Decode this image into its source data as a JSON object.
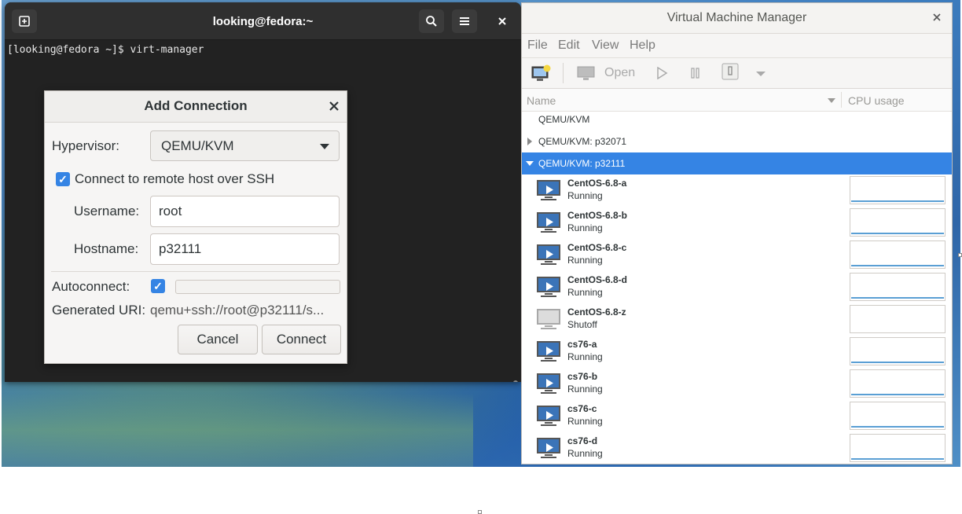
{
  "terminal": {
    "title": "looking@fedora:~",
    "prompt_line": "[looking@fedora ~]$ virt-manager"
  },
  "add_connection": {
    "title": "Add Connection",
    "hypervisor_label": "Hypervisor:",
    "hypervisor_value": "QEMU/KVM",
    "ssh_checkbox_label": "Connect to remote host over SSH",
    "ssh_checked": true,
    "username_label": "Username:",
    "username_value": "root",
    "hostname_label": "Hostname:",
    "hostname_value": "p32111",
    "autoconnect_label": "Autoconnect:",
    "autoconnect_checked": true,
    "uri_label": "Generated URI:",
    "uri_value": "qemu+ssh://root@p32111/s...",
    "cancel_label": "Cancel",
    "connect_label": "Connect"
  },
  "vmm": {
    "title": "Virtual Machine Manager",
    "menu": [
      "File",
      "Edit",
      "View",
      "Help"
    ],
    "toolbar": {
      "open_label": "Open"
    },
    "columns": {
      "name": "Name",
      "cpu": "CPU usage"
    },
    "connections": [
      {
        "label": "QEMU/KVM",
        "state": "none"
      },
      {
        "label": "QEMU/KVM: p32071",
        "state": "collapsed"
      },
      {
        "label": "QEMU/KVM: p32111",
        "state": "expanded-selected"
      }
    ],
    "vms": [
      {
        "name": "CentOS-6.8-a",
        "status": "Running"
      },
      {
        "name": "CentOS-6.8-b",
        "status": "Running"
      },
      {
        "name": "CentOS-6.8-c",
        "status": "Running"
      },
      {
        "name": "CentOS-6.8-d",
        "status": "Running"
      },
      {
        "name": "CentOS-6.8-z",
        "status": "Shutoff"
      },
      {
        "name": "cs76-a",
        "status": "Running"
      },
      {
        "name": "cs76-b",
        "status": "Running"
      },
      {
        "name": "cs76-c",
        "status": "Running"
      },
      {
        "name": "cs76-d",
        "status": "Running"
      }
    ]
  },
  "colors": {
    "accent": "#3584e4",
    "terminal_bg": "#242424"
  }
}
